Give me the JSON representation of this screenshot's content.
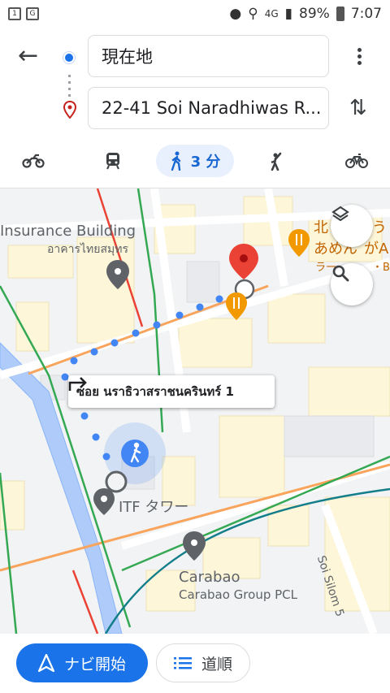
{
  "status_bar": {
    "left_icons": [
      "1",
      "G"
    ],
    "network": "4G",
    "battery": "89%",
    "time": "7:07"
  },
  "directions": {
    "origin": "現在地",
    "destination": "22-41 Soi Naradhiwas R..."
  },
  "modes": [
    {
      "name": "motorcycle",
      "icon": "motorcycle-icon",
      "label": ""
    },
    {
      "name": "transit",
      "icon": "transit-icon",
      "label": ""
    },
    {
      "name": "walking",
      "icon": "walking-icon",
      "label": "3 分",
      "selected": true
    },
    {
      "name": "ride-hailing",
      "icon": "hail-icon",
      "label": ""
    },
    {
      "name": "cycling",
      "icon": "bicycle-icon",
      "label": ""
    }
  ],
  "map": {
    "places": {
      "insurance_en": "Insurance Building",
      "insurance_th": "อาคารไทยสมุทร",
      "restaurant_1": "北",
      "restaurant_2": "う",
      "restaurant_3": "あめん",
      "restaurant_4": "がA",
      "restaurant_5": "ラー",
      "restaurant_6": "・B",
      "itf": "ITF タワー",
      "carabao": "Carabao",
      "carabao_sub": "Carabao Group PCL",
      "road": "Soi Silom 5"
    },
    "turn_instruction": "ซอย นราธิวาสราชนครินทร์ 1"
  },
  "actions": {
    "start": "ナビ開始",
    "steps": "道順"
  },
  "colors": {
    "accent": "#1a73e8",
    "route_dot": "#4285f4",
    "pin": "#ea4335",
    "poi_food": "#f29900"
  }
}
